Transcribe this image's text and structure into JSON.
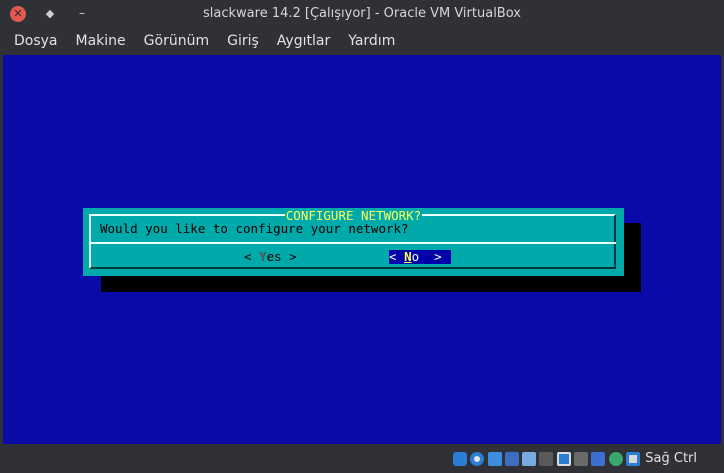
{
  "window": {
    "title": "slackware 14.2 [Çalışıyor] - Oracle VM VirtualBox",
    "close_glyph": "✕",
    "max_glyph": "◆",
    "min_glyph": "–"
  },
  "menubar": {
    "items": [
      "Dosya",
      "Makine",
      "Görünüm",
      "Giriş",
      "Aygıtlar",
      "Yardım"
    ]
  },
  "dialog": {
    "title": "CONFIGURE NETWORK?",
    "message": "Would you like to configure your network?",
    "yes_button": {
      "left": "< ",
      "hotkey": "Y",
      "rest": "es",
      "right": " >"
    },
    "no_button": {
      "left": "< ",
      "hotkey": "N",
      "rest": "o",
      "right": "  >"
    },
    "focused_button": "No"
  },
  "statusbar": {
    "icons": [
      "hard-disk-icon",
      "optical-drive-icon",
      "audio-icon",
      "network-icon",
      "usb-icon",
      "shared-folders-icon",
      "display-icon",
      "recording-icon",
      "virtualization-icon",
      "mouse-integration-icon",
      "keyboard-icon"
    ],
    "host_key": "Sağ Ctrl"
  },
  "colors": {
    "vm_background": "#0a0aa8",
    "dialog_background": "#00aaaa",
    "dialog_title": "#ffff55",
    "focused_button_bg": "#0000aa"
  }
}
